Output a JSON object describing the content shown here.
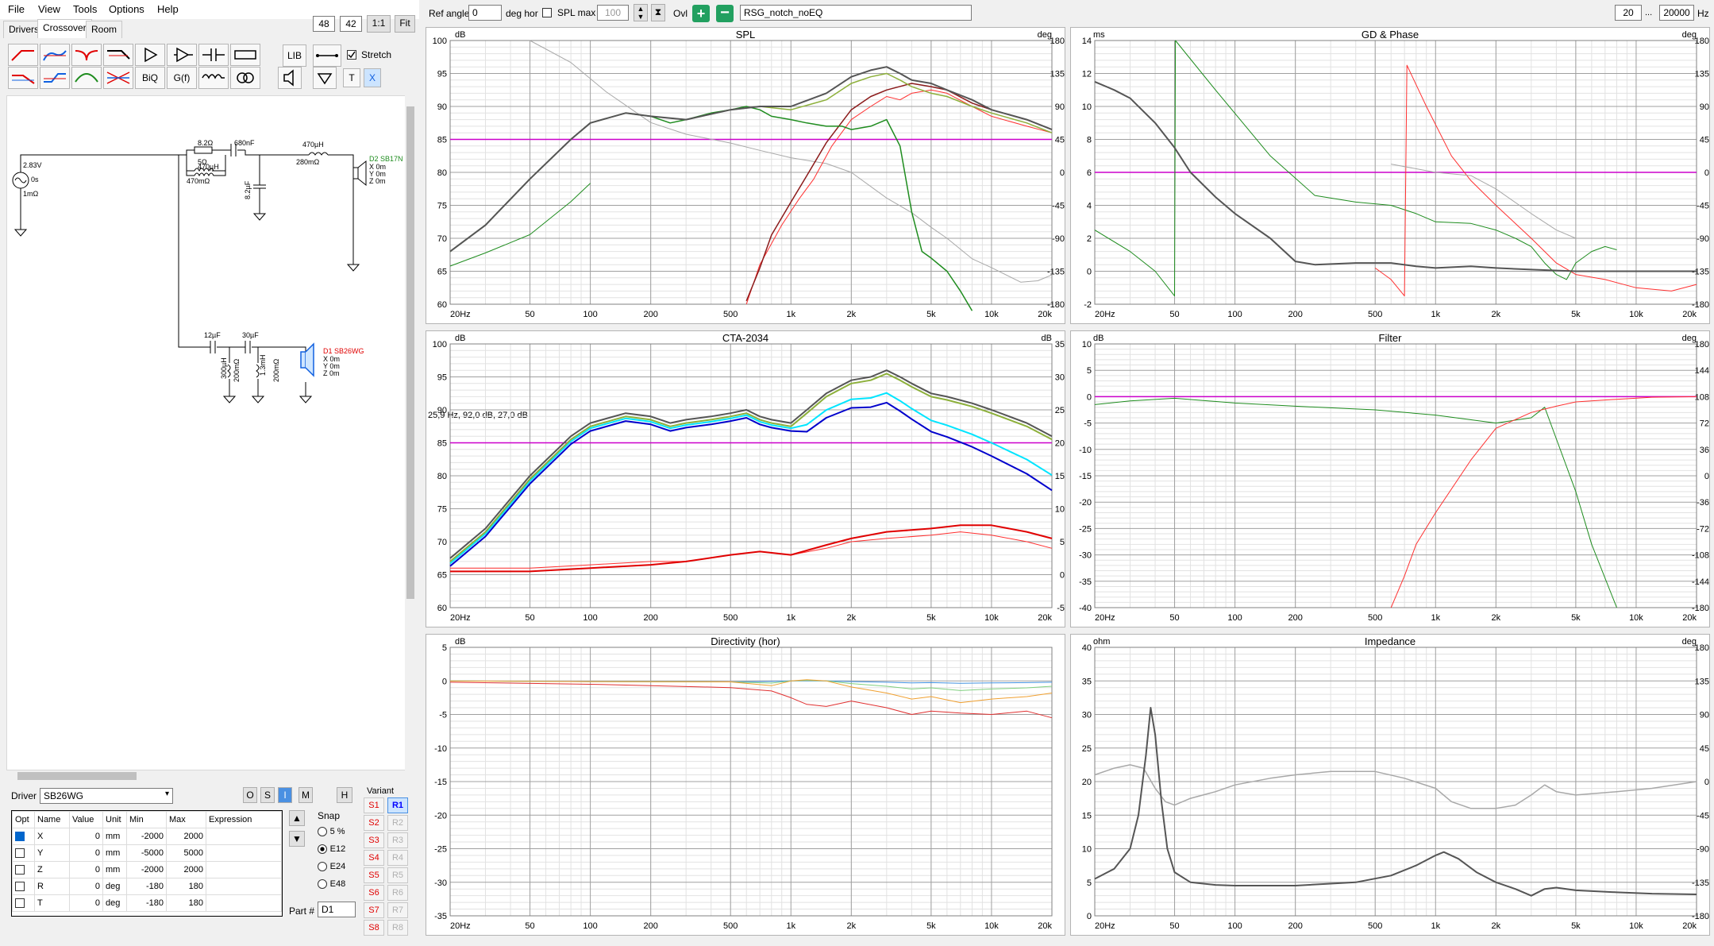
{
  "menu": [
    "File",
    "View",
    "Tools",
    "Options",
    "Help"
  ],
  "tabs": [
    "Drivers",
    "Crossover",
    "Room"
  ],
  "zoom": {
    "v1": "48",
    "v2": "42",
    "one": "1:1",
    "fit": "Fit"
  },
  "toolbar": {
    "lib": "LIB",
    "stretch": "Stretch",
    "biq": "BiQ",
    "gf": "G(f)",
    "t": "T",
    "x": "X"
  },
  "top": {
    "ref_angle_label": "Ref angle",
    "ref_angle": "0",
    "deg_hor": "deg hor",
    "spl_max_label": "SPL max",
    "spl_max": "100",
    "ovl": "Ovl",
    "overlay_name": "RSG_notch_noEQ",
    "f_min": "20",
    "dots": "...",
    "f_max": "20000",
    "hz": "Hz"
  },
  "schematic": {
    "source": [
      "2.83V",
      "0s",
      "1mΩ"
    ],
    "r1": "8.2Ω",
    "c1": "680nF",
    "l1": "470µH",
    "l1r": "280mΩ",
    "l2": "470µH",
    "l2r": "470mΩ",
    "lx": "5Ω",
    "c2": "8.2µF",
    "d2": [
      "D2 SB17N",
      "X 0m",
      "Y 0m",
      "Z 0m"
    ],
    "c3": "12µF",
    "c4": "30µF",
    "l3": "300µH",
    "l3r": "200mΩ",
    "l4": "1.3mH",
    "l4r": "200mΩ",
    "d1": [
      "D1 SB26WG",
      "X 0m",
      "Y 0m",
      "Z 0m"
    ]
  },
  "driver": {
    "label": "Driver",
    "value": "SB26WG",
    "modes": [
      "O",
      "S",
      "I",
      "M",
      "H"
    ]
  },
  "params": {
    "headers": [
      "Opt",
      "Name",
      "Value",
      "Unit",
      "Min",
      "Max",
      "Expression"
    ],
    "rows": [
      {
        "name": "X",
        "value": "0",
        "unit": "mm",
        "min": "-2000",
        "max": "2000",
        "opt": true
      },
      {
        "name": "Y",
        "value": "0",
        "unit": "mm",
        "min": "-5000",
        "max": "5000",
        "opt": false
      },
      {
        "name": "Z",
        "value": "0",
        "unit": "mm",
        "min": "-2000",
        "max": "2000",
        "opt": false
      },
      {
        "name": "R",
        "value": "0",
        "unit": "deg",
        "min": "-180",
        "max": "180",
        "opt": false
      },
      {
        "name": "T",
        "value": "0",
        "unit": "deg",
        "min": "-180",
        "max": "180",
        "opt": false
      }
    ]
  },
  "snap": {
    "label": "Snap",
    "options": [
      "5 %",
      "E12",
      "E24",
      "E48"
    ],
    "selected": 1
  },
  "part": {
    "label": "Part #",
    "value": "D1"
  },
  "variant": {
    "label": "Variant",
    "s": [
      "S1",
      "S2",
      "S3",
      "S4",
      "S5",
      "S6",
      "S7",
      "S8"
    ],
    "r": [
      "R1",
      "R2",
      "R3",
      "R4",
      "R5",
      "R6",
      "R7",
      "R8"
    ]
  },
  "graphs": {
    "spl": {
      "title": "SPL",
      "unit_l": "dB",
      "unit_r": "deg",
      "yticks": [
        "100",
        "95",
        "90",
        "85",
        "80",
        "75",
        "70",
        "65",
        "60"
      ],
      "y2ticks": [
        "180",
        "135",
        "90",
        "45",
        "0",
        "-45",
        "-90",
        "-135",
        "-180"
      ]
    },
    "gd": {
      "title": "GD & Phase",
      "unit_l": "ms",
      "unit_r": "deg",
      "yticks": [
        "14",
        "12",
        "10",
        "8",
        "6",
        "4",
        "2",
        "0",
        "-2"
      ],
      "y2ticks": [
        "180",
        "135",
        "90",
        "45",
        "0",
        "-45",
        "-90",
        "-135",
        "-180"
      ]
    },
    "cta": {
      "title": "CTA-2034",
      "unit_l": "dB",
      "unit_r": "dB",
      "yticks": [
        "100",
        "95",
        "90",
        "85",
        "80",
        "75",
        "70",
        "65",
        "60"
      ],
      "y2ticks": [
        "35",
        "30",
        "25",
        "20",
        "15",
        "10",
        "5",
        "0",
        "-5"
      ],
      "cursor": "25,9 Hz, 92,0 dB, 27,0 dB"
    },
    "filter": {
      "title": "Filter",
      "unit_l": "dB",
      "unit_r": "deg",
      "yticks": [
        "10",
        "5",
        "0",
        "-5",
        "-10",
        "-15",
        "-20",
        "-25",
        "-30",
        "-35",
        "-40"
      ],
      "y2ticks": [
        "180",
        "144",
        "108",
        "72",
        "36",
        "0",
        "-36",
        "-72",
        "-108",
        "-144",
        "-180"
      ]
    },
    "dir": {
      "title": "Directivity (hor)",
      "unit_l": "dB",
      "yticks": [
        "5",
        "0",
        "-5",
        "-10",
        "-15",
        "-20",
        "-25",
        "-30",
        "-35"
      ]
    },
    "imp": {
      "title": "Impedance",
      "unit_l": "ohm",
      "unit_r": "deg",
      "yticks": [
        "40",
        "35",
        "30",
        "25",
        "20",
        "15",
        "10",
        "5",
        "0"
      ],
      "y2ticks": [
        "180",
        "135",
        "90",
        "45",
        "0",
        "-45",
        "-90",
        "-135",
        "-180"
      ]
    }
  },
  "xticks": [
    {
      "f": 20,
      "l": "20Hz"
    },
    {
      "f": 50,
      "l": "50"
    },
    {
      "f": 100,
      "l": "100"
    },
    {
      "f": 200,
      "l": "200"
    },
    {
      "f": 500,
      "l": "500"
    },
    {
      "f": 1000,
      "l": "1k"
    },
    {
      "f": 2000,
      "l": "2k"
    },
    {
      "f": 5000,
      "l": "5k"
    },
    {
      "f": 10000,
      "l": "10k"
    },
    {
      "f": 20000,
      "l": "20k"
    }
  ],
  "colors": {
    "grid_major": "#a0a0a0",
    "grid_minor": "#e2e2e2",
    "magenta": "#cc00cc",
    "dark": "#555555",
    "olive": "#8db03a",
    "darkred": "#8b1a1a",
    "red": "#ff3030",
    "green": "#1e8c1e",
    "gray": "#a8a8a8",
    "cyan": "#00e5ff",
    "blue": "#0000cc",
    "orange": "#f0a030",
    "lightgreen": "#80d080",
    "blue2": "#4090e0"
  }
}
